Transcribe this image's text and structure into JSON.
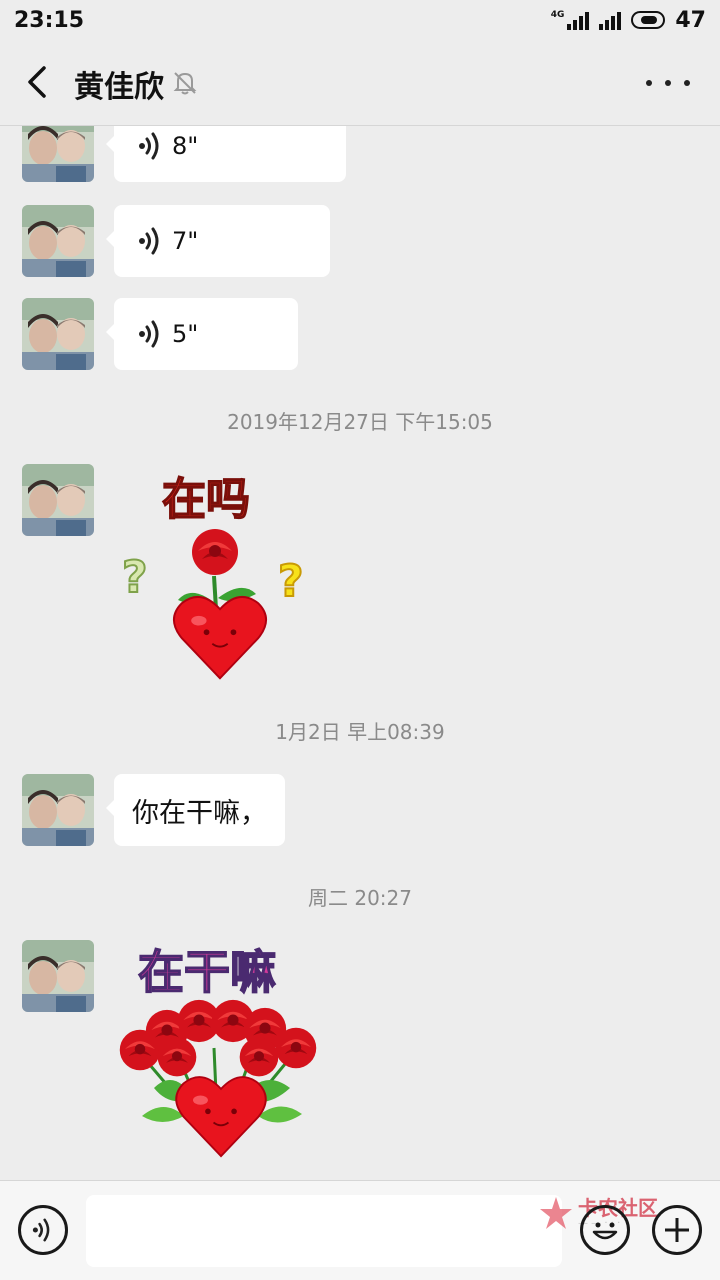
{
  "status_bar": {
    "time": "23:15",
    "network": "4G",
    "battery": "47"
  },
  "header": {
    "title": "黄佳欣"
  },
  "messages": {
    "voice_1": {
      "duration": "8\""
    },
    "voice_2": {
      "duration": "7\""
    },
    "voice_3": {
      "duration": "5\""
    },
    "timestamp_1": "2019年12月27日 下午15:05",
    "sticker_1": {
      "caption": "在吗"
    },
    "timestamp_2": "1月2日 早上08:39",
    "text_1": "你在干嘛，",
    "timestamp_3": "周二 20:27",
    "sticker_2": {
      "caption": "在干嘛"
    }
  },
  "input_bar": {
    "value": "",
    "placeholder": ""
  },
  "watermark": {
    "text": "卡农社区"
  },
  "colors": {
    "background": "#ededed",
    "bubble": "#ffffff",
    "timestamp": "#8a8a8a",
    "watermark": "#d64a5a"
  },
  "icons": [
    "back-icon",
    "mute-bell-icon",
    "more-icon",
    "voice-icon",
    "emoji-icon",
    "plus-icon"
  ]
}
